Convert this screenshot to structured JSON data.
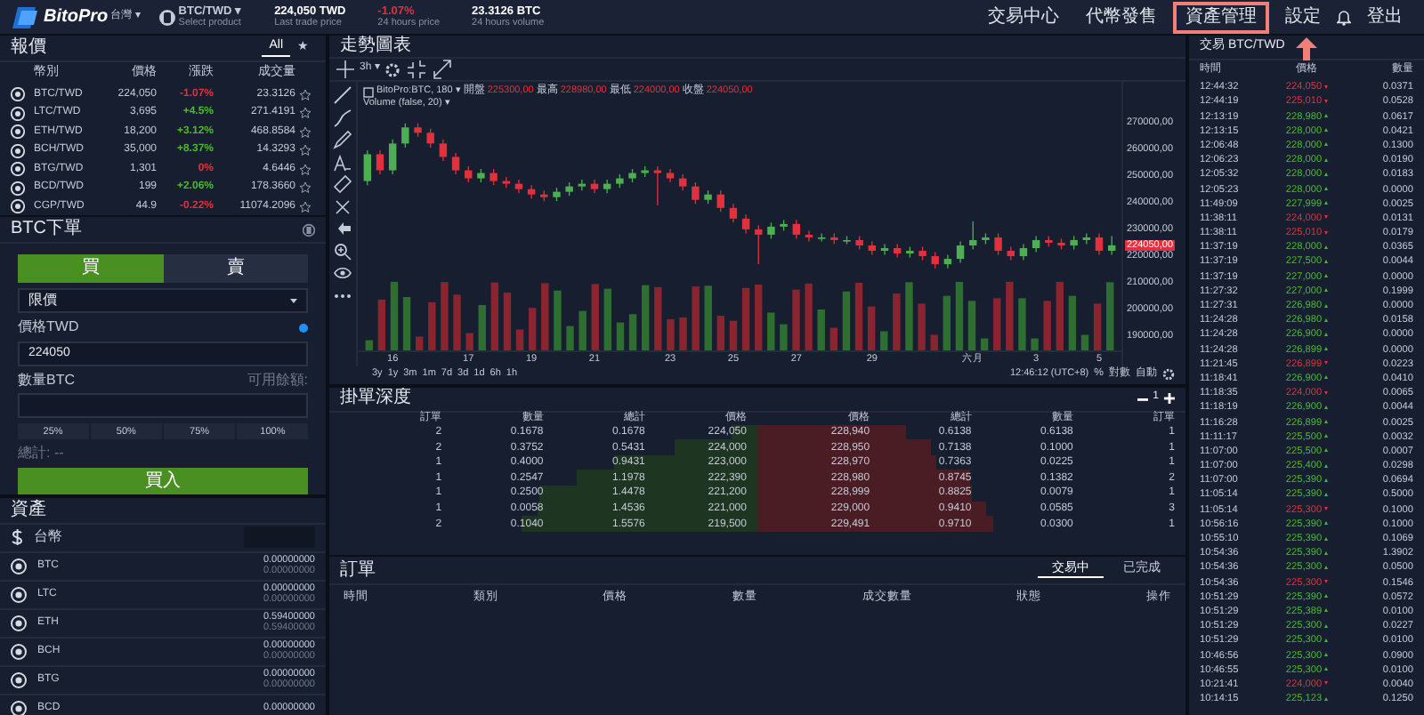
{
  "header": {
    "logo": "BitoPro",
    "region": "台灣 ▾",
    "product": "BTC/TWD ▾",
    "product_hint": "Select product",
    "stats": [
      {
        "value": "224,050 TWD",
        "label": "Last trade price",
        "color": "#ffffff"
      },
      {
        "value": "-1.07%",
        "label": "24 hours price",
        "color": "#e0313d"
      },
      {
        "value": "23.3126 BTC",
        "label": "24 hours volume",
        "color": "#ffffff"
      }
    ],
    "nav": [
      {
        "kind": "link",
        "label": "交易中心",
        "highlighted": false
      },
      {
        "kind": "link",
        "label": "代幣發售",
        "highlighted": false
      },
      {
        "kind": "link",
        "label": "資產管理",
        "highlighted": true
      },
      {
        "kind": "link",
        "label": "設定",
        "highlighted": false
      },
      {
        "kind": "bell"
      },
      {
        "kind": "link",
        "label": "登出",
        "highlighted": false
      }
    ]
  },
  "quotes": {
    "title": "報價",
    "tabs": [
      {
        "label": "All",
        "selected": true
      },
      {
        "label": "★",
        "selected": false
      }
    ],
    "columns": [
      "幣別",
      "價格",
      "漲跌",
      "成交量"
    ],
    "rows": [
      {
        "pair": "BTC/TWD",
        "price": "224,050",
        "change": "-1.07%",
        "color": "#e0313d",
        "volume": "23.3126"
      },
      {
        "pair": "LTC/TWD",
        "price": "3,695",
        "change": "+4.5%",
        "color": "#4cbb2a",
        "volume": "271.4191"
      },
      {
        "pair": "ETH/TWD",
        "price": "18,200",
        "change": "+3.12%",
        "color": "#4cbb2a",
        "volume": "468.8584"
      },
      {
        "pair": "BCH/TWD",
        "price": "35,000",
        "change": "+8.37%",
        "color": "#4cbb2a",
        "volume": "14.3293"
      },
      {
        "pair": "BTG/TWD",
        "price": "1,301",
        "change": "0%",
        "color": "#e0313d",
        "volume": "4.6446"
      },
      {
        "pair": "BCD/TWD",
        "price": "199",
        "change": "+2.06%",
        "color": "#4cbb2a",
        "volume": "178.3660"
      },
      {
        "pair": "CGP/TWD",
        "price": "44.9",
        "change": "-0.22%",
        "color": "#e0313d",
        "volume": "11074.2096"
      }
    ]
  },
  "order_form": {
    "title": "BTC下單",
    "sides": [
      {
        "label": "買",
        "selected": true
      },
      {
        "label": "賣",
        "selected": false
      }
    ],
    "order_type": "限價",
    "price_label": "價格TWD",
    "price_value": "224050",
    "amount_label": "數量BTC",
    "available_label": "可用餘額:",
    "percent_buttons": [
      "25%",
      "50%",
      "75%",
      "100%"
    ],
    "total": "總計: --",
    "submit": "買入"
  },
  "assets": {
    "title": "資產",
    "rows": [
      {
        "kind": "fiat",
        "name": "台幣"
      },
      {
        "kind": "coin",
        "name": "BTC",
        "balances": [
          "0.00000000",
          "0.00000000"
        ]
      },
      {
        "kind": "coin",
        "name": "LTC",
        "balances": [
          "0.00000000",
          "0.00000000"
        ]
      },
      {
        "kind": "coin",
        "name": "ETH",
        "balances": [
          "0.59400000",
          "0.59400000"
        ]
      },
      {
        "kind": "coin",
        "name": "BCH",
        "balances": [
          "0.00000000",
          "0.00000000"
        ]
      },
      {
        "kind": "coin",
        "name": "BTG",
        "balances": [
          "0.00000000",
          "0.00000000"
        ]
      },
      {
        "kind": "coin",
        "name": "BCD",
        "balances": [
          "0.00000000"
        ]
      }
    ]
  },
  "chart": {
    "title": "走勢圖表",
    "interval": "3h ▾",
    "symbol": "BitoPro:BTC, 180 ▾",
    "legend": [
      {
        "label": "開盤",
        "value": "225300,00"
      },
      {
        "label": "最高",
        "value": "228980,00"
      },
      {
        "label": "最低",
        "value": "224000,00"
      },
      {
        "label": "收盤",
        "value": "224050,00"
      }
    ],
    "volume_label": "Volume (false, 20) ▾",
    "last_price_tag": "224050,00",
    "ranges": [
      "3y",
      "1y",
      "3m",
      "1m",
      "7d",
      "3d",
      "1d",
      "6h",
      "1h"
    ],
    "clock": "12:46:12 (UTC+8)",
    "options": [
      "%",
      "對數",
      "自動"
    ],
    "chart_data": {
      "type": "candlestick",
      "ylim": [
        185000,
        285000
      ],
      "yticks": [
        {
          "value": 270000,
          "label": "270000,00"
        },
        {
          "value": 260000,
          "label": "260000,00"
        },
        {
          "value": 250000,
          "label": "250000,00"
        },
        {
          "value": 240000,
          "label": "240000,00"
        },
        {
          "value": 230000,
          "label": "230000,00"
        },
        {
          "value": 220000,
          "label": "220000,00"
        },
        {
          "value": 210000,
          "label": "210000,00"
        },
        {
          "value": 200000,
          "label": "200000,00"
        },
        {
          "value": 190000,
          "label": "190000,00"
        }
      ],
      "categories": [
        null,
        null,
        "16",
        null,
        null,
        null,
        null,
        null,
        "17",
        null,
        null,
        null,
        null,
        "19",
        null,
        null,
        null,
        null,
        "21",
        null,
        null,
        null,
        null,
        null,
        "23",
        null,
        null,
        null,
        null,
        "25",
        null,
        null,
        null,
        null,
        "27",
        null,
        null,
        null,
        null,
        null,
        "29",
        null,
        null,
        null,
        null,
        null,
        null,
        null,
        "六月",
        null,
        null,
        null,
        null,
        "3",
        null,
        null,
        null,
        null,
        "5",
        null
      ],
      "ohlc": [
        [
          248000,
          259500,
          246500,
          258000
        ],
        [
          258000,
          259500,
          250500,
          252000
        ],
        [
          252000,
          263500,
          250500,
          262000
        ],
        [
          262000,
          269500,
          260500,
          268000
        ],
        [
          268000,
          269500,
          264500,
          266000
        ],
        [
          266000,
          267500,
          260500,
          262000
        ],
        [
          262000,
          263500,
          255500,
          257000
        ],
        [
          257000,
          258500,
          250500,
          252000
        ],
        [
          252000,
          253500,
          247500,
          249000
        ],
        [
          249000,
          252500,
          247500,
          251000
        ],
        [
          251000,
          252500,
          246500,
          248000
        ],
        [
          248000,
          249500,
          245500,
          247000
        ],
        [
          247000,
          248500,
          243500,
          245000
        ],
        [
          245000,
          246500,
          241500,
          243000
        ],
        [
          243000,
          244500,
          240500,
          242000
        ],
        [
          242000,
          245500,
          240500,
          244000
        ],
        [
          244000,
          247500,
          242500,
          246000
        ],
        [
          246000,
          248500,
          244500,
          247000
        ],
        [
          247000,
          248500,
          243500,
          245000
        ],
        [
          245000,
          248500,
          243500,
          247000
        ],
        [
          247000,
          250500,
          245500,
          249000
        ],
        [
          249000,
          252500,
          247500,
          251000
        ],
        [
          251000,
          253500,
          249500,
          252000
        ],
        [
          252000,
          253500,
          239000,
          251000
        ],
        [
          251000,
          252500,
          247500,
          249000
        ],
        [
          249000,
          250500,
          244500,
          246000
        ],
        [
          246000,
          247500,
          239500,
          241000
        ],
        [
          241000,
          244500,
          239500,
          243000
        ],
        [
          243000,
          244500,
          236500,
          238000
        ],
        [
          238000,
          239500,
          232500,
          234000
        ],
        [
          234000,
          235500,
          228500,
          230000
        ],
        [
          230000,
          231500,
          217000,
          228000
        ],
        [
          228000,
          232500,
          226500,
          231000
        ],
        [
          231000,
          233500,
          229500,
          232000
        ],
        [
          232000,
          233500,
          226500,
          228000
        ],
        [
          228000,
          229500,
          225500,
          227000
        ],
        [
          227000,
          228500,
          225500,
          227000
        ],
        [
          227000,
          228500,
          224500,
          226000
        ],
        [
          226000,
          227500,
          224500,
          226000
        ],
        [
          226000,
          227500,
          222500,
          224000
        ],
        [
          224000,
          225500,
          220500,
          222000
        ],
        [
          222000,
          224500,
          220500,
          223000
        ],
        [
          223000,
          224500,
          219500,
          221000
        ],
        [
          221000,
          223500,
          219500,
          222000
        ],
        [
          222000,
          223500,
          218500,
          220000
        ],
        [
          220000,
          221500,
          215500,
          217000
        ],
        [
          217000,
          220500,
          215500,
          219000
        ],
        [
          219000,
          225500,
          217500,
          224000
        ],
        [
          224000,
          233000,
          222500,
          226000
        ],
        [
          226000,
          228500,
          224500,
          227000
        ],
        [
          227000,
          228500,
          220500,
          222000
        ],
        [
          222000,
          223500,
          218500,
          220000
        ],
        [
          220000,
          224500,
          218500,
          223000
        ],
        [
          223000,
          227500,
          221500,
          226000
        ],
        [
          226000,
          227500,
          223500,
          225000
        ],
        [
          225000,
          226500,
          222500,
          224000
        ],
        [
          224000,
          227500,
          222500,
          226000
        ],
        [
          226000,
          228500,
          224500,
          227000
        ],
        [
          227000,
          228500,
          220500,
          222000
        ],
        [
          222000,
          227500,
          220500,
          224050
        ]
      ]
    }
  },
  "order_book": {
    "title": "掛單深度",
    "precision": "1",
    "bid_columns": [
      "訂單",
      "數量",
      "總計",
      "價格"
    ],
    "ask_columns": [
      "價格",
      "總計",
      "數量",
      "訂單"
    ],
    "bids": [
      {
        "orders": "2",
        "qty": "0.1678",
        "total": "0.1678",
        "price": "224,050"
      },
      {
        "orders": "2",
        "qty": "0.3752",
        "total": "0.5431",
        "price": "224,000"
      },
      {
        "orders": "1",
        "qty": "0.4000",
        "total": "0.9431",
        "price": "223,000"
      },
      {
        "orders": "1",
        "qty": "0.2547",
        "total": "1.1978",
        "price": "222,390"
      },
      {
        "orders": "1",
        "qty": "0.2500",
        "total": "1.4478",
        "price": "221,200"
      },
      {
        "orders": "1",
        "qty": "0.0058",
        "total": "1.4536",
        "price": "221,000"
      },
      {
        "orders": "2",
        "qty": "0.1040",
        "total": "1.5576",
        "price": "219,500"
      }
    ],
    "asks": [
      {
        "price": "228,940",
        "total": "0.6138",
        "qty": "0.6138",
        "orders": "1"
      },
      {
        "price": "228,950",
        "total": "0.7138",
        "qty": "0.1000",
        "orders": "1"
      },
      {
        "price": "228,970",
        "total": "0.7363",
        "qty": "0.0225",
        "orders": "1"
      },
      {
        "price": "228,980",
        "total": "0.8745",
        "qty": "0.1382",
        "orders": "2"
      },
      {
        "price": "228,999",
        "total": "0.8825",
        "qty": "0.0079",
        "orders": "1"
      },
      {
        "price": "229,000",
        "total": "0.9410",
        "qty": "0.0585",
        "orders": "3"
      },
      {
        "price": "229,491",
        "total": "0.9710",
        "qty": "0.0300",
        "orders": "1"
      }
    ]
  },
  "orders": {
    "title": "訂單",
    "tabs": [
      {
        "label": "交易中",
        "selected": true
      },
      {
        "label": "已完成",
        "selected": false
      }
    ],
    "columns": [
      "時間",
      "類別",
      "價格",
      "數量",
      "成交數量",
      "狀態",
      "操作"
    ]
  },
  "trades": {
    "title": "交易 BTC/TWD",
    "columns": [
      "時間",
      "價格",
      "數量"
    ],
    "rows": [
      {
        "time": "12:44:32",
        "price": "224,050",
        "qty": "0.0371",
        "kind": "sell"
      },
      {
        "time": "12:44:19",
        "price": "225,010",
        "qty": "0.0528",
        "kind": "sell"
      },
      {
        "time": "12:13:19",
        "price": "228,980",
        "qty": "0.0617",
        "kind": "buy"
      },
      {
        "time": "12:13:15",
        "price": "228,000",
        "qty": "0.0421",
        "kind": "buy"
      },
      {
        "time": "12:06:48",
        "price": "228,000",
        "qty": "0.1300",
        "kind": "buy"
      },
      {
        "time": "12:06:23",
        "price": "228,000",
        "qty": "0.0190",
        "kind": "buy"
      },
      {
        "time": "12:05:32",
        "price": "228,000",
        "qty": "0.0183",
        "kind": "buy"
      },
      {
        "time": "12:05:23",
        "price": "228,000",
        "qty": "0.0000",
        "kind": "buy"
      },
      {
        "time": "11:49:09",
        "price": "227,999",
        "qty": "0.0025",
        "kind": "buy"
      },
      {
        "time": "11:38:11",
        "price": "224,000",
        "qty": "0.0131",
        "kind": "sell"
      },
      {
        "time": "11:38:11",
        "price": "225,010",
        "qty": "0.0179",
        "kind": "sell"
      },
      {
        "time": "11:37:19",
        "price": "228,000",
        "qty": "0.0365",
        "kind": "buy"
      },
      {
        "time": "11:37:19",
        "price": "227,500",
        "qty": "0.0044",
        "kind": "buy"
      },
      {
        "time": "11:37:19",
        "price": "227,000",
        "qty": "0.0000",
        "kind": "buy"
      },
      {
        "time": "11:27:32",
        "price": "227,000",
        "qty": "0.1999",
        "kind": "buy"
      },
      {
        "time": "11:27:31",
        "price": "226,980",
        "qty": "0.0000",
        "kind": "buy"
      },
      {
        "time": "11:24:28",
        "price": "226,980",
        "qty": "0.0158",
        "kind": "buy"
      },
      {
        "time": "11:24:28",
        "price": "226,900",
        "qty": "0.0000",
        "kind": "buy"
      },
      {
        "time": "11:24:28",
        "price": "226,899",
        "qty": "0.0000",
        "kind": "buy"
      },
      {
        "time": "11:21:45",
        "price": "226,899",
        "qty": "0.0223",
        "kind": "sell"
      },
      {
        "time": "11:18:41",
        "price": "226,900",
        "qty": "0.0410",
        "kind": "buy"
      },
      {
        "time": "11:18:35",
        "price": "224,000",
        "qty": "0.0065",
        "kind": "sell"
      },
      {
        "time": "11:18:19",
        "price": "226,900",
        "qty": "0.0044",
        "kind": "buy"
      },
      {
        "time": "11:16:28",
        "price": "226,899",
        "qty": "0.0025",
        "kind": "buy"
      },
      {
        "time": "11:11:17",
        "price": "225,500",
        "qty": "0.0032",
        "kind": "buy"
      },
      {
        "time": "11:07:00",
        "price": "225,500",
        "qty": "0.0007",
        "kind": "buy"
      },
      {
        "time": "11:07:00",
        "price": "225,400",
        "qty": "0.0298",
        "kind": "buy"
      },
      {
        "time": "11:07:00",
        "price": "225,390",
        "qty": "0.0694",
        "kind": "buy"
      },
      {
        "time": "11:05:14",
        "price": "225,390",
        "qty": "0.5000",
        "kind": "buy"
      },
      {
        "time": "11:05:14",
        "price": "225,300",
        "qty": "0.1000",
        "kind": "sell"
      },
      {
        "time": "10:56:16",
        "price": "225,390",
        "qty": "0.1000",
        "kind": "buy"
      },
      {
        "time": "10:55:10",
        "price": "225,390",
        "qty": "0.1069",
        "kind": "buy"
      },
      {
        "time": "10:54:36",
        "price": "225,390",
        "qty": "1.3902",
        "kind": "buy"
      },
      {
        "time": "10:54:36",
        "price": "225,300",
        "qty": "0.0500",
        "kind": "buy"
      },
      {
        "time": "10:54:36",
        "price": "225,300",
        "qty": "0.1546",
        "kind": "sell"
      },
      {
        "time": "10:51:29",
        "price": "225,390",
        "qty": "0.0572",
        "kind": "buy"
      },
      {
        "time": "10:51:29",
        "price": "225,389",
        "qty": "0.0100",
        "kind": "buy"
      },
      {
        "time": "10:51:29",
        "price": "225,300",
        "qty": "0.0227",
        "kind": "buy"
      },
      {
        "time": "10:51:29",
        "price": "225,300",
        "qty": "0.0100",
        "kind": "buy"
      },
      {
        "time": "10:46:56",
        "price": "225,300",
        "qty": "0.0900",
        "kind": "buy"
      },
      {
        "time": "10:46:55",
        "price": "225,300",
        "qty": "0.0100",
        "kind": "buy"
      },
      {
        "time": "10:21:41",
        "price": "224,000",
        "qty": "0.0040",
        "kind": "sell"
      },
      {
        "time": "10:14:15",
        "price": "225,123",
        "qty": "0.1250",
        "kind": "buy"
      }
    ]
  }
}
